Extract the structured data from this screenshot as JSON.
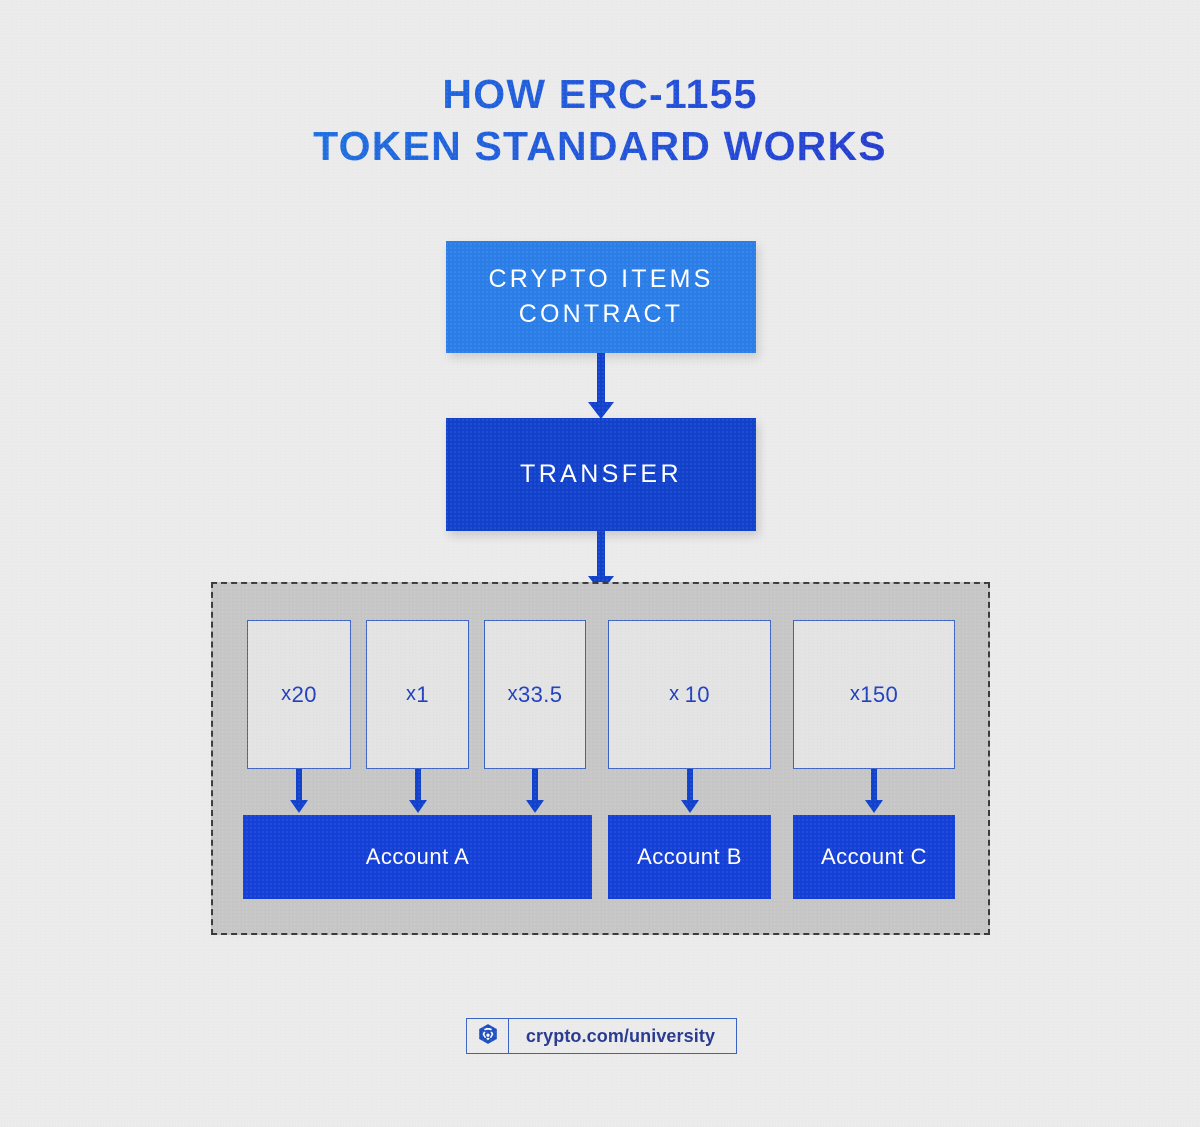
{
  "title": {
    "text": "How ERC-1155\nToken Standard Works",
    "gradient_from": "#1a84ea",
    "gradient_to": "#2c27bd"
  },
  "flow": {
    "contract": {
      "label": "Crypto Items\nContract",
      "color": "#2b7ee8"
    },
    "transfer": {
      "label": "Transfer",
      "color": "#1242cc"
    },
    "arrow_color": "#1242cc"
  },
  "accounts_panel": {
    "panel_color": "#c6c6c6",
    "border_style": "dashed",
    "border_color": "#3b3b3b",
    "tokens": [
      {
        "prefix": "x",
        "amount": "20",
        "to": "Account A"
      },
      {
        "prefix": "x",
        "amount": "1",
        "to": "Account A"
      },
      {
        "prefix": "x",
        "amount": "33.5",
        "to": "Account A"
      },
      {
        "prefix": "x",
        "amount": "10",
        "to": "Account B"
      },
      {
        "prefix": "x",
        "amount": "150",
        "to": "Account C"
      }
    ],
    "accounts": [
      {
        "label": "Account A",
        "color": "#1540d8"
      },
      {
        "label": "Account B",
        "color": "#1540d8"
      },
      {
        "label": "Account C",
        "color": "#1540d8"
      }
    ],
    "token_box_fill": "#e3e3e3",
    "token_box_border": "#3a63c4",
    "token_text_color": "#1f3fbe"
  },
  "footer": {
    "logo_icon": "crypto-com-logo-icon",
    "url": "crypto.com/university",
    "accent": "#27398f"
  },
  "page": {
    "background": "#ebebeb"
  }
}
